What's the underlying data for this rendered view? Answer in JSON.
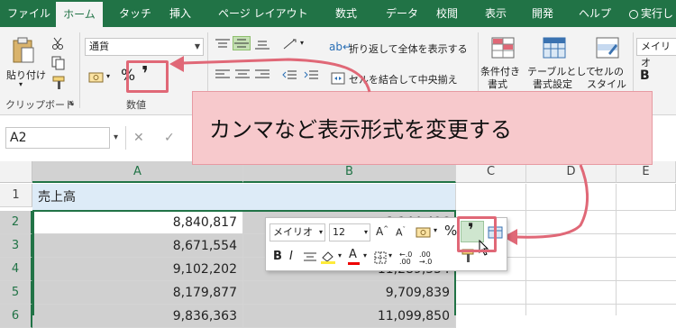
{
  "tabs": [
    "ファイル",
    "ホーム",
    "タッチ",
    "挿入",
    "ページ レイアウト",
    "数式",
    "データ",
    "校閲",
    "表示",
    "開発",
    "ヘルプ",
    "実行し"
  ],
  "ribbon": {
    "clipboard": {
      "paste": "貼り付け",
      "group": "クリップボード"
    },
    "number": {
      "format": "通貨",
      "percent": "%",
      "comma": "❜",
      "group": "数値"
    },
    "alignment": {
      "wrap": "折り返して全体を表示する",
      "merge": "セルを結合して中央揃え"
    },
    "styles": {
      "cond_line1": "条件付き",
      "cond_line2": "書式",
      "table_line1": "テーブルとして",
      "table_line2": "書式設定",
      "cell_line1": "セルの",
      "cell_line2": "スタイル"
    },
    "font": "メイリオ"
  },
  "formula_bar": {
    "name_box": "A2",
    "cancel": "✕",
    "enter": "✓"
  },
  "callout": "カンマなど表示形式を変更する",
  "grid": {
    "columns": [
      "A",
      "B",
      "C",
      "D",
      "E"
    ],
    "rows": [
      "1",
      "2",
      "3",
      "4",
      "5",
      "6"
    ],
    "title": "売上高",
    "col_a": [
      "8,840,817",
      "8,671,554",
      "9,102,202",
      "8,179,877",
      "9,836,363"
    ],
    "col_b": [
      "8,144,496",
      "11,289,354",
      "9,709,839",
      "11,099,850"
    ]
  },
  "mini_toolbar": {
    "font": "メイリオ",
    "size": "12",
    "percent": "%",
    "comma": "❜"
  },
  "colors": {
    "accent": "#217346",
    "callout": "#f7c9cc",
    "arrow": "#e06877"
  }
}
